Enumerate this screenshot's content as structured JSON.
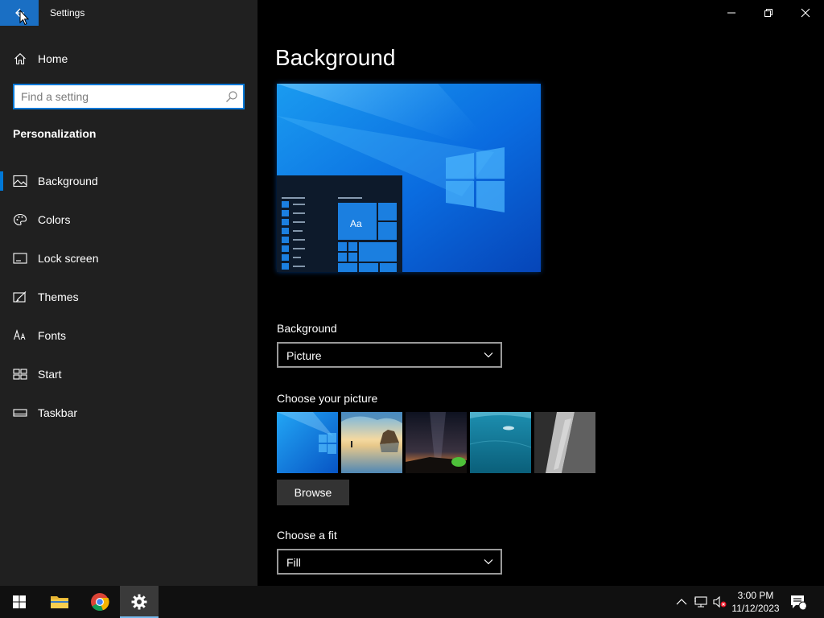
{
  "window": {
    "title": "Settings"
  },
  "sidebar": {
    "home_label": "Home",
    "search_placeholder": "Find a setting",
    "section_title": "Personalization",
    "items": [
      {
        "label": "Background",
        "icon": "picture-icon",
        "active": true
      },
      {
        "label": "Colors",
        "icon": "palette-icon"
      },
      {
        "label": "Lock screen",
        "icon": "lock-screen-icon"
      },
      {
        "label": "Themes",
        "icon": "themes-icon"
      },
      {
        "label": "Fonts",
        "icon": "fonts-icon"
      },
      {
        "label": "Start",
        "icon": "start-icon"
      },
      {
        "label": "Taskbar",
        "icon": "taskbar-icon"
      }
    ]
  },
  "main": {
    "title": "Background",
    "preview_tile_label": "Aa",
    "background_label": "Background",
    "background_value": "Picture",
    "choose_picture_label": "Choose your picture",
    "browse_label": "Browse",
    "fit_label": "Choose a fit",
    "fit_value": "Fill"
  },
  "taskbar": {
    "time": "3:00 PM",
    "date": "11/12/2023",
    "notification_count": "1"
  },
  "colors": {
    "accent": "#0078d7",
    "sidebar_bg": "#202020",
    "main_bg": "#000000",
    "taskbar_bg": "#101010"
  }
}
